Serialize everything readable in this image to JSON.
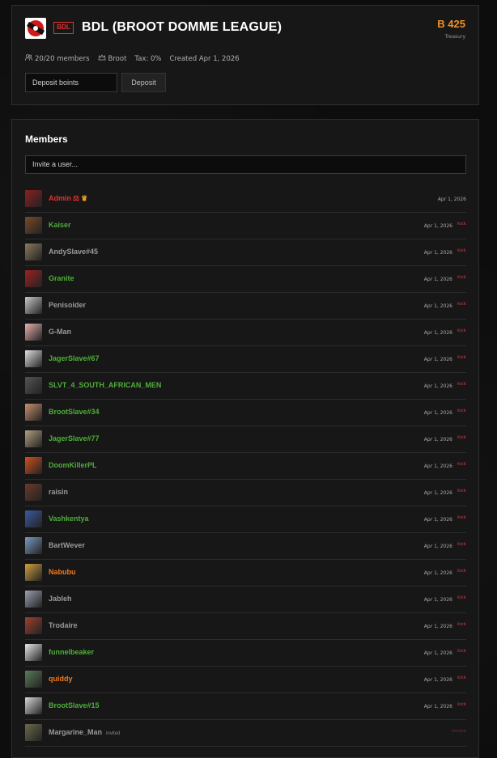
{
  "league": {
    "tag": "BDL",
    "name": "BDL (BROOT DOMME LEAGUE)",
    "treasury_amount": "B 425",
    "treasury_label": "Treasury",
    "members_count": "20/20 members",
    "owner": "Broot",
    "tax": "Tax: 0%",
    "created": "Created Apr 1, 2026",
    "deposit_placeholder": "Deposit boints",
    "deposit_button": "Deposit"
  },
  "members_section": {
    "title": "Members",
    "invite_placeholder": "Invite a user..."
  },
  "members": [
    {
      "name": "Admin",
      "role": "owner",
      "color": "red",
      "date": "Apr 1, 2026",
      "kick": "",
      "avatar": "#8a2020"
    },
    {
      "name": "Kaiser",
      "color": "green",
      "date": "Apr 1, 2026",
      "kick": "kick",
      "avatar": "#7a4a2a"
    },
    {
      "name": "AndySlave#45",
      "color": "gray",
      "date": "Apr 1, 2026",
      "kick": "kick",
      "avatar": "#8a7a5a"
    },
    {
      "name": "Granite",
      "color": "green",
      "date": "Apr 1, 2026",
      "kick": "kick",
      "avatar": "#a02020"
    },
    {
      "name": "Penisoider",
      "color": "gray",
      "date": "Apr 1, 2026",
      "kick": "kick",
      "avatar": "#c8c8c8"
    },
    {
      "name": "G-Man",
      "color": "gray",
      "date": "Apr 1, 2026",
      "kick": "kick",
      "avatar": "#e8b0b0"
    },
    {
      "name": "JagerSlave#67",
      "color": "green",
      "date": "Apr 1, 2026",
      "kick": "kick",
      "avatar": "#e0e0e0"
    },
    {
      "name": "SLVT_4_SOUTH_AFRICAN_MEN",
      "color": "green",
      "date": "Apr 1, 2026",
      "kick": "kick",
      "avatar": "#555555"
    },
    {
      "name": "BrootSlave#34",
      "color": "green",
      "date": "Apr 1, 2026",
      "kick": "kick",
      "avatar": "#c89070"
    },
    {
      "name": "JagerSlave#77",
      "color": "green",
      "date": "Apr 1, 2026",
      "kick": "kick",
      "avatar": "#b0a080"
    },
    {
      "name": "DoomKillerPL",
      "color": "green",
      "date": "Apr 1, 2026",
      "kick": "kick",
      "avatar": "#d05020"
    },
    {
      "name": "raisin",
      "color": "gray",
      "date": "Apr 1, 2026",
      "kick": "kick",
      "avatar": "#6a3a2a"
    },
    {
      "name": "Vashkentya",
      "color": "green",
      "date": "Apr 1, 2026",
      "kick": "kick",
      "avatar": "#3a5aa0"
    },
    {
      "name": "BartWever",
      "color": "gray",
      "date": "Apr 1, 2026",
      "kick": "kick",
      "avatar": "#7a9ac0"
    },
    {
      "name": "Nabubu",
      "color": "orange",
      "date": "Apr 1, 2026",
      "kick": "kick",
      "avatar": "#d0a040"
    },
    {
      "name": "Jableh",
      "color": "gray",
      "date": "Apr 1, 2026",
      "kick": "kick",
      "avatar": "#9aa0b0"
    },
    {
      "name": "Trodaire",
      "color": "gray",
      "date": "Apr 1, 2026",
      "kick": "kick",
      "avatar": "#a04030"
    },
    {
      "name": "funnelbeaker",
      "color": "green",
      "date": "Apr 1, 2026",
      "kick": "kick",
      "avatar": "#e8e8e8"
    },
    {
      "name": "quiddy",
      "color": "orange",
      "date": "Apr 1, 2026",
      "kick": "kick",
      "avatar": "#5a7a5a"
    },
    {
      "name": "BrootSlave#15",
      "color": "green",
      "date": "Apr 1, 2026",
      "kick": "kick",
      "avatar": "#d8d8d8"
    },
    {
      "name": "Margarine_Man",
      "color": "gray",
      "invited": "invited",
      "date": "",
      "kick": "revoke",
      "avatar": "#6a6a4a"
    }
  ]
}
